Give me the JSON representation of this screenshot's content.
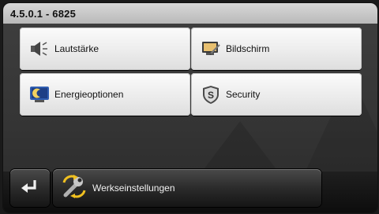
{
  "header": {
    "version": "4.5.0.1 - 6825"
  },
  "tiles": [
    {
      "label": "Lautstärke",
      "icon": "speaker-icon"
    },
    {
      "label": "Bildschirm",
      "icon": "monitor-icon"
    },
    {
      "label": "Energieoptionen",
      "icon": "energy-moon-icon"
    },
    {
      "label": "Security",
      "icon": "shield-icon"
    }
  ],
  "footer": {
    "back_icon": "return-arrow-icon",
    "reset_label": "Werkseinstellungen",
    "reset_icon": "wrench-reset-icon"
  },
  "colors": {
    "accent": "#f0c020",
    "tile_bg": "#eeeeee",
    "screen_bg": "#3a3a3a"
  }
}
